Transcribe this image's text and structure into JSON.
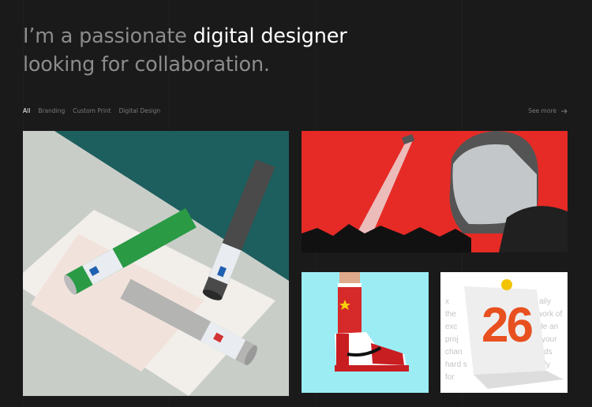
{
  "hero": {
    "line1_muted": "I’m a passionate ",
    "line1_highlight": "digital designer",
    "line2": "looking for collaboration."
  },
  "filters": [
    {
      "label": "All",
      "active": true
    },
    {
      "label": "Branding",
      "active": false
    },
    {
      "label": "Custom Print",
      "active": false
    },
    {
      "label": "Digital Design",
      "active": false
    }
  ],
  "see_more": {
    "label": "See more",
    "icon": "arrow-right-icon"
  },
  "portfolio": [
    {
      "name": "tube-packaging-mockup",
      "colors": [
        "#1d5e5e",
        "#2a9a45",
        "#4a4a4a",
        "#b4b4b2"
      ]
    },
    {
      "name": "riot-helmet-poster",
      "colors": [
        "#e62b26"
      ]
    },
    {
      "name": "sneaker-illustration",
      "colors": [
        "#9cecf4",
        "#d62929"
      ]
    },
    {
      "name": "calendar-print-mockup",
      "colors": [
        "#e8501f"
      ],
      "poster_number": "26"
    }
  ],
  "colors": {
    "accent": "#ffffff",
    "muted": "#8c8c8c",
    "background": "#1a1a1a"
  }
}
